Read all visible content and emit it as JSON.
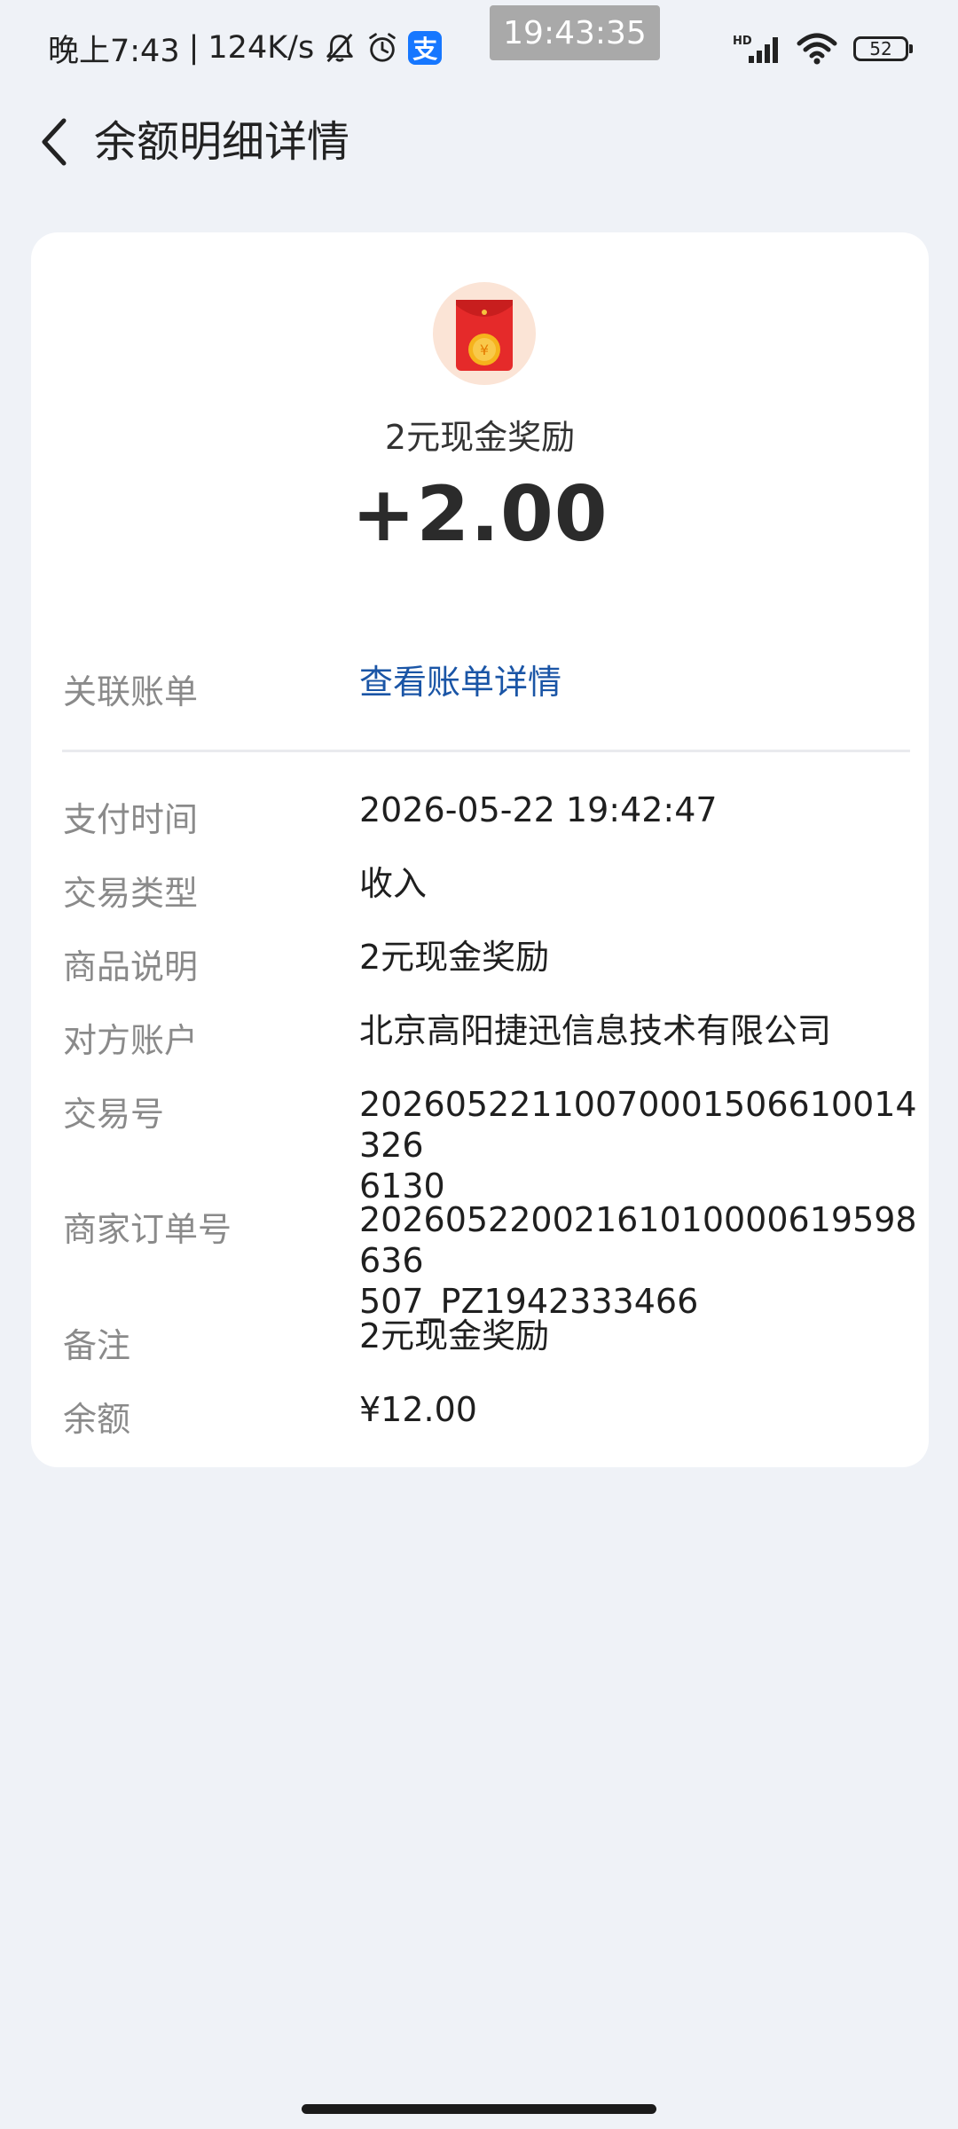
{
  "status_bar": {
    "time": "晚上7:43",
    "network_speed": "124K/s",
    "floating_clock": "19:43:35",
    "battery_level": "52",
    "icons": [
      "bell-off-icon",
      "alarm-icon",
      "alipay-icon",
      "hd-signal-icon",
      "wifi-icon",
      "battery-icon"
    ]
  },
  "header": {
    "title": "余额明细详情",
    "back_icon": "chevron-left-icon"
  },
  "summary": {
    "icon": "red-envelope-icon",
    "product_title": "2元现金奖励",
    "amount": "+2.00"
  },
  "linked_bill": {
    "label": "关联账单",
    "value": "查看账单详情"
  },
  "details": [
    {
      "label": "支付时间",
      "value": "2026-05-22 19:42:47"
    },
    {
      "label": "交易类型",
      "value": "收入"
    },
    {
      "label": "商品说明",
      "value": "2元现金奖励"
    },
    {
      "label": "对方账户",
      "value": "北京高阳捷迅信息技术有限公司"
    },
    {
      "label": "交易号",
      "value": "2026052211007000150661001432 6130",
      "line1": "20260522110070001506610014326",
      "line2": "6130"
    },
    {
      "label": "商家订单号",
      "line1": "20260522002161010000619598636",
      "line2": "507_PZ1942333466"
    },
    {
      "label": "备注",
      "value": "2元现金奖励"
    },
    {
      "label": "余额",
      "value": "¥12.00"
    }
  ],
  "colors": {
    "background": "#eff2f7",
    "card": "#ffffff",
    "link": "#1a55a6",
    "label": "#8a8a8a",
    "alipay_blue": "#1677ff",
    "envelope_red": "#e52a2a"
  }
}
